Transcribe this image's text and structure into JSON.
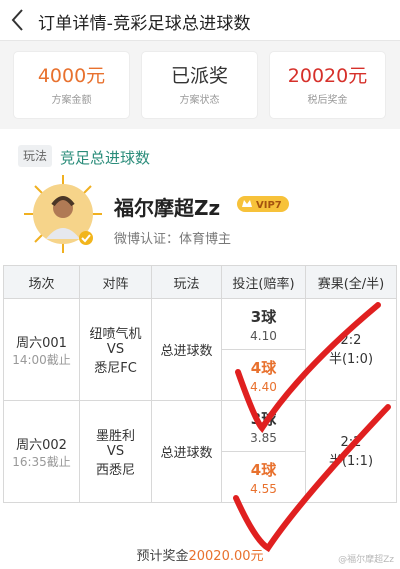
{
  "header": {
    "title": "订单详情-竞彩足球总进球数"
  },
  "summary": [
    {
      "value": "4000元",
      "label": "方案金额"
    },
    {
      "value": "已派奖",
      "label": "方案状态"
    },
    {
      "value": "20020元",
      "label": "税后奖金"
    }
  ],
  "expert": {
    "tag": "玩法",
    "play_type": "竞足总进球数",
    "name": "福尔摩超Zz",
    "vip": "VIP7",
    "weibo": "微博认证：体育博主"
  },
  "table": {
    "headers": [
      "场次",
      "对阵",
      "玩法",
      "投注(赔率)",
      "赛果(全/半)"
    ],
    "rows": [
      {
        "match_no": "周六001",
        "deadline": "14:00截止",
        "home": "纽喷气机",
        "vs": "VS",
        "away": "悉尼FC",
        "play": "总进球数",
        "pick1": "3球",
        "odd1": "4.10",
        "pick2": "4球",
        "odd2": "4.40",
        "result_full": "2:2",
        "result_half": "半(1:0)"
      },
      {
        "match_no": "周六002",
        "deadline": "16:35截止",
        "home": "墨胜利",
        "vs": "VS",
        "away": "西悉尼",
        "play": "总进球数",
        "pick1": "3球",
        "odd1": "3.85",
        "pick2": "4球",
        "odd2": "4.55",
        "result_full": "2:2",
        "result_half": "半(1:1)"
      }
    ]
  },
  "footer": {
    "prize_label": "预计奖金",
    "prize_value": "20020.00元",
    "watermark": "@福尔摩超Zz"
  },
  "colors": {
    "accent": "#e8712e",
    "teal": "#2a8c7a",
    "check_red": "#e02020"
  }
}
